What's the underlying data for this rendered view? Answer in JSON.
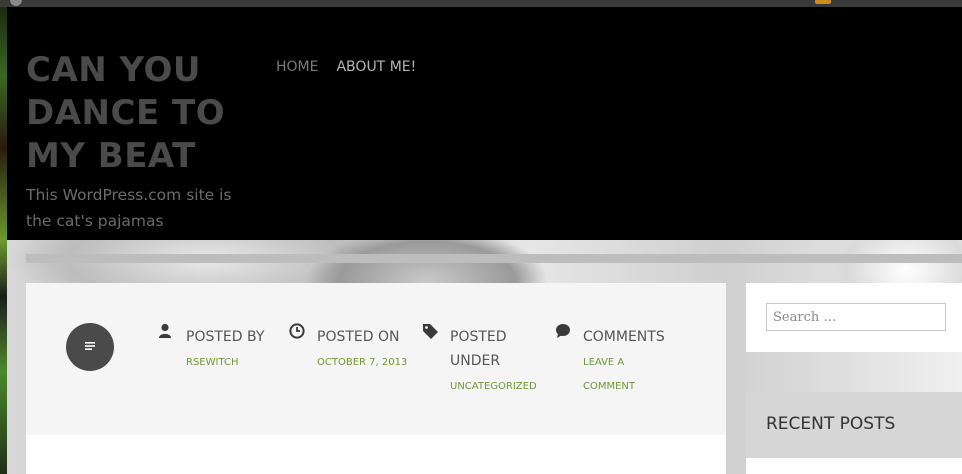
{
  "site": {
    "title": "CAN YOU DANCE TO MY BEAT",
    "description": "This WordPress.com site is the cat's pajamas"
  },
  "nav": {
    "items": [
      {
        "label": "HOME"
      },
      {
        "label": "ABOUT ME!"
      }
    ]
  },
  "post_meta": {
    "format_icon": "standard-post-format-icon",
    "author": {
      "label": "POSTED BY",
      "value": "RSEWITCH",
      "icon": "person-icon"
    },
    "date": {
      "label": "POSTED ON",
      "value": "OCTOBER 7, 2013",
      "icon": "clock-icon"
    },
    "category": {
      "label": "POSTED UNDER",
      "value": "UNCATEGORIZED",
      "icon": "tag-icon"
    },
    "comments": {
      "label": "COMMENTS",
      "value": "LEAVE A COMMENT",
      "icon": "speech-bubble-icon"
    }
  },
  "sidebar": {
    "search": {
      "placeholder": "Search …"
    },
    "recent_posts": {
      "title": "RECENT POSTS"
    }
  },
  "colors": {
    "accent_link": "#6e9a30",
    "header_bg": "#000000",
    "card_bg": "#f5f5f5"
  }
}
